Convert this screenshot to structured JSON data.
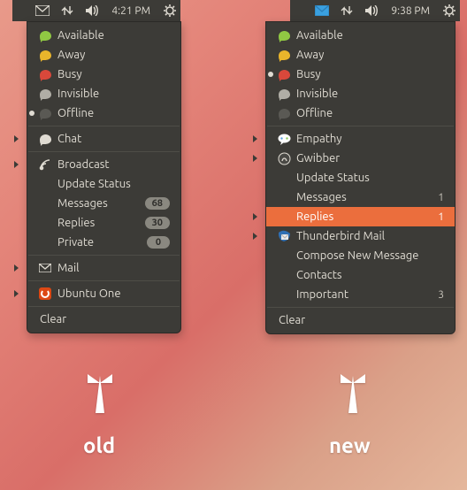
{
  "panels": {
    "old": {
      "time": "4:21 PM"
    },
    "new": {
      "time": "9:38 PM"
    }
  },
  "status_labels": {
    "available": "Available",
    "away": "Away",
    "busy": "Busy",
    "invisible": "Invisible",
    "offline": "Offline"
  },
  "old_menu": {
    "current_status": "offline",
    "chat": "Chat",
    "broadcast": "Broadcast",
    "update_status": "Update Status",
    "messages": {
      "label": "Messages",
      "count": "68"
    },
    "replies": {
      "label": "Replies",
      "count": "30"
    },
    "private": {
      "label": "Private",
      "count": "0"
    },
    "mail": "Mail",
    "ubuntu_one": "Ubuntu One",
    "clear": "Clear"
  },
  "new_menu": {
    "current_status": "busy",
    "empathy": "Empathy",
    "gwibber": "Gwibber",
    "update_status": "Update Status",
    "messages": {
      "label": "Messages",
      "count": "1"
    },
    "replies": {
      "label": "Replies",
      "count": "1"
    },
    "thunderbird": "Thunderbird Mail",
    "compose": "Compose New Message",
    "contacts": "Contacts",
    "important": {
      "label": "Important",
      "count": "3"
    },
    "clear": "Clear"
  },
  "annotations": {
    "old": "old",
    "new": "new"
  },
  "colors": {
    "highlight": "#eb6e3d",
    "panel": "#3c3b37"
  }
}
